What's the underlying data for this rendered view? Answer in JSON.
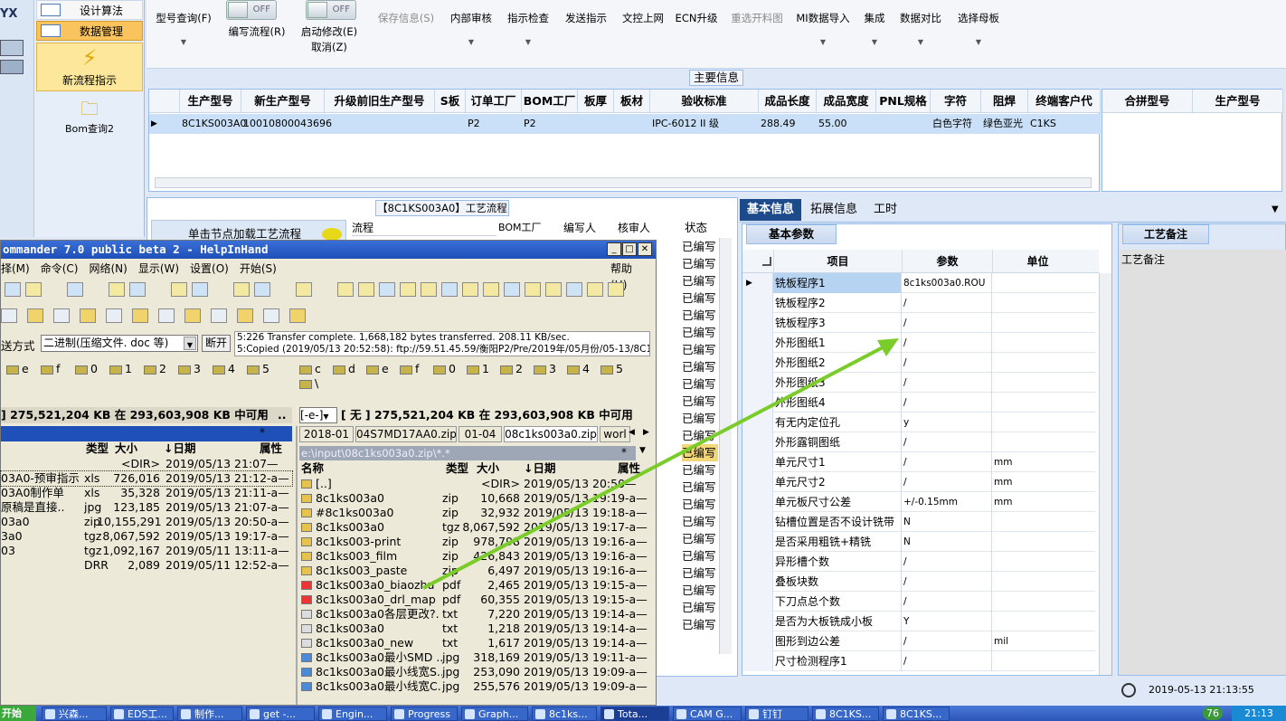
{
  "nav": {
    "logo": "YX",
    "items": [
      "设计算法",
      "数据管理"
    ],
    "big_items": [
      "新流程指示",
      "Bom查询2"
    ]
  },
  "toolbar": {
    "buttons": [
      "型号查询(F)",
      "编写流程(R)",
      "启动修改(E)",
      "取消(Z)",
      "保存信息(S)",
      "内部审核",
      "指示检查",
      "发送指示",
      "文控上网",
      "ECN升级",
      "重选开料图",
      "MI数据导入",
      "集成",
      "数据对比",
      "选择母板"
    ],
    "toggle_off": "OFF"
  },
  "main_info": {
    "title": "主要信息",
    "columns": [
      "生产型号",
      "新生产型号",
      "升级前旧生产型号",
      "S板",
      "订单工厂",
      "BOM工厂",
      "板厚",
      "板材",
      "验收标准",
      "成品长度",
      "成品宽度",
      "PNL规格",
      "字符",
      "阻焊",
      "终端客户代"
    ],
    "row": [
      "8C1KS003A0",
      "10010800043696",
      "",
      "",
      "P2",
      "P2",
      "",
      "",
      "IPC-6012 II 级",
      "288.49",
      "55.00",
      "",
      "白色字符",
      "绿色亚光",
      "C1KS"
    ],
    "side_columns": [
      "合拼型号",
      "生产型号"
    ]
  },
  "process": {
    "title": "【8C1KS003A0】工艺流程",
    "load_btn": "单击节点加载工艺流程",
    "columns": [
      "流程",
      "BOM工厂",
      "编写人",
      "核审人",
      "状态"
    ],
    "status": [
      "已编写",
      "已编写",
      "已编写",
      "已编写",
      "已编写",
      "已编写",
      "已编写",
      "已编写",
      "已编写",
      "已编写",
      "已编写",
      "已编写",
      "已编写",
      "已编写",
      "已编写",
      "已编写",
      "已编写",
      "已编写",
      "已编写",
      "已编写",
      "已编写",
      "已编写",
      "已编写"
    ]
  },
  "right_panel": {
    "tabs": [
      "基本信息",
      "拓展信息",
      "工时"
    ],
    "subtab": "基本参数",
    "columns": [
      "项目",
      "参数",
      "单位"
    ],
    "rows": [
      [
        "铣板程序1",
        "8c1ks003a0.ROU",
        ""
      ],
      [
        "铣板程序2",
        "/",
        ""
      ],
      [
        "铣板程序3",
        "/",
        ""
      ],
      [
        "外形图纸1",
        "/",
        ""
      ],
      [
        "外形图纸2",
        "/",
        ""
      ],
      [
        "外形图纸3",
        "/",
        ""
      ],
      [
        "外形图纸4",
        "/",
        ""
      ],
      [
        "有无内定位孔",
        "y",
        ""
      ],
      [
        "外形露铜图纸",
        "/",
        ""
      ],
      [
        "单元尺寸1",
        "/",
        "mm"
      ],
      [
        "单元尺寸2",
        "/",
        "mm"
      ],
      [
        "单元板尺寸公差",
        "+/-0.15mm",
        "mm"
      ],
      [
        "钻槽位置是否不设计铣带",
        "N",
        ""
      ],
      [
        "是否采用粗铣+精铣",
        "N",
        ""
      ],
      [
        "异形槽个数",
        "/",
        ""
      ],
      [
        "叠板块数",
        "/",
        ""
      ],
      [
        "下刀点总个数",
        "/",
        ""
      ],
      [
        "是否为大板铣成小板",
        "Y",
        ""
      ],
      [
        "图形到边公差",
        "/",
        "mil"
      ],
      [
        "尺寸检测程序1",
        "/",
        ""
      ]
    ],
    "notes_tab": "工艺备注",
    "notes_label": "工艺备注",
    "datetime": "2019-05-13 21:13:55"
  },
  "tc": {
    "title": "ommander 7.0 public beta 2 - HelpInHand",
    "menu": [
      "择(M)",
      "命令(C)",
      "网络(N)",
      "显示(W)",
      "设置(O)",
      "开始(S)"
    ],
    "help": "帮助(H)",
    "transfer_label": "送方式",
    "transfer_mode": "二进制(压缩文件. doc 等)",
    "disconnect": "断开",
    "log": [
      "5:226 Transfer complete. 1,668,182 bytes transferred. 208.11 KB/sec.",
      "5:Copied (2019/05/13 20:52:58): ftp://59.51.45.59/衡阳P2/Pre/2019年/05月份/05-13/8C1"
    ],
    "left_drives": [
      "e",
      "f",
      "0",
      "1",
      "2",
      "3",
      "4",
      "5"
    ],
    "right_drives": [
      "c",
      "d",
      "e",
      "f",
      "0",
      "1",
      "2",
      "3",
      "4",
      "5",
      "\\"
    ],
    "left_free": "] 275,521,204 KB 在 293,603,908 KB 中可用",
    "right_sel": "[-e-]",
    "right_free": "[ 无 ] 275,521,204 KB 在 293,603,908 KB 中可用",
    "right_tabs": [
      "2018-01",
      "04S7MD17AA0.zip",
      "01-04",
      "08c1ks003a0.zip",
      "worl"
    ],
    "path": "e:\\input\\08c1ks003a0.zip\\*.*",
    "cols": [
      "名称",
      "类型",
      "大小",
      "↓日期",
      "属性"
    ],
    "left_cols": [
      "类型",
      "大小",
      "↓日期",
      "属性"
    ],
    "left_files": [
      [
        "",
        "",
        "<DIR>",
        "2019/05/13 21:07—",
        ""
      ],
      [
        "03A0-预审指示",
        "xls",
        "726,016",
        "2019/05/13 21:12-a—",
        ""
      ],
      [
        "03A0制作单",
        "xls",
        "35,328",
        "2019/05/13 21:11-a—",
        ""
      ],
      [
        "原稿是直接..",
        "jpg",
        "123,185",
        "2019/05/13 21:07-a—",
        ""
      ],
      [
        "03a0",
        "zip",
        "10,155,291",
        "2019/05/13 20:50-a—",
        ""
      ],
      [
        "3a0",
        "tgz",
        "8,067,592",
        "2019/05/13 19:17-a—",
        ""
      ],
      [
        "03",
        "tgz",
        "1,092,167",
        "2019/05/11 13:11-a—",
        ""
      ],
      [
        "",
        "DRR",
        "2,089",
        "2019/05/11 12:52-a—",
        ""
      ]
    ],
    "right_files": [
      [
        "[..]",
        "",
        "<DIR>",
        "2019/05/13 20:50—"
      ],
      [
        "8c1ks003a0",
        "zip",
        "10,668",
        "2019/05/13 19:19-a—"
      ],
      [
        "#8c1ks003a0",
        "zip",
        "32,932",
        "2019/05/13 19:18-a—"
      ],
      [
        "8c1ks003a0",
        "tgz",
        "8,067,592",
        "2019/05/13 19:17-a—"
      ],
      [
        "8c1ks003-print",
        "zip",
        "978,798",
        "2019/05/13 19:16-a—"
      ],
      [
        "8c1ks003_film",
        "zip",
        "426,843",
        "2019/05/13 19:16-a—"
      ],
      [
        "8c1ks003_paste",
        "zip",
        "6,497",
        "2019/05/13 19:16-a—"
      ],
      [
        "8c1ks003a0_biaozhu",
        "pdf",
        "2,465",
        "2019/05/13 19:15-a—"
      ],
      [
        "8c1ks003a0_drl_map",
        "pdf",
        "60,355",
        "2019/05/13 19:15-a—"
      ],
      [
        "8c1ks003a0各层更改?.",
        "txt",
        "7,220",
        "2019/05/13 19:14-a—"
      ],
      [
        "8c1ks003a0",
        "txt",
        "1,218",
        "2019/05/13 19:14-a—"
      ],
      [
        "8c1ks003a0_new",
        "txt",
        "1,617",
        "2019/05/13 19:14-a—"
      ],
      [
        "8c1ks003a0最小SMD ..",
        "jpg",
        "318,169",
        "2019/05/13 19:11-a—"
      ],
      [
        "8c1ks003a0最小线宽S..",
        "jpg",
        "253,090",
        "2019/05/13 19:09-a—"
      ],
      [
        "8c1ks003a0最小线宽C..",
        "jpg",
        "255,576",
        "2019/05/13 19:09-a—"
      ]
    ]
  },
  "taskbar": {
    "start": "开始",
    "tasks": [
      "兴森...",
      "EDS工...",
      "制作...",
      "get -...",
      "Engin...",
      "Progress",
      "Graph...",
      "8c1ks...",
      "Tota...",
      "CAM G...",
      "钉钉",
      "8C1KS...",
      "8C1KS..."
    ],
    "time": "21:13",
    "badge": "76"
  }
}
